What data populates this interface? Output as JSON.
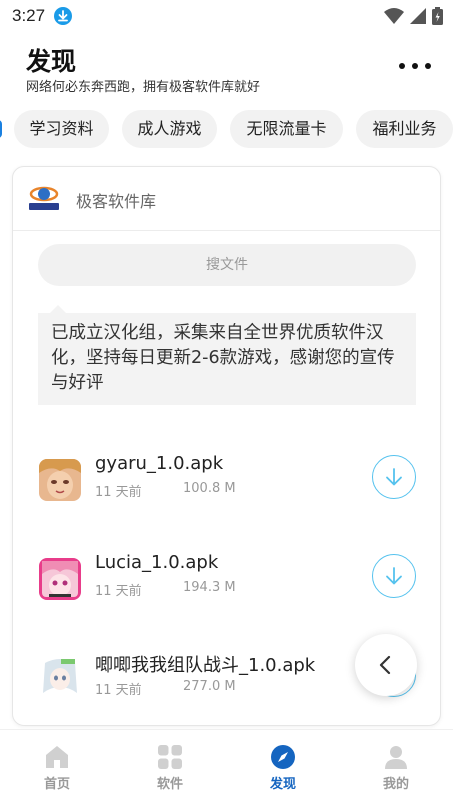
{
  "status_bar": {
    "time": "3:27"
  },
  "header": {
    "title": "发现",
    "subtitle": "网络何必东奔西跑，拥有极客软件库就好"
  },
  "chips": [
    "学习资料",
    "成人游戏",
    "无限流量卡",
    "福利业务"
  ],
  "card": {
    "site_name": "极客软件库",
    "search_placeholder": "搜文件",
    "notice": "已成立汉化组，采集来自全世界优质软件汉化，坚持每日更新2-6款游戏，感谢您的宣传与好评",
    "files": [
      {
        "name": "gyaru_1.0.apk",
        "date": "11 天前",
        "size": "100.8 M"
      },
      {
        "name": "Lucia_1.0.apk",
        "date": "11 天前",
        "size": "194.3 M"
      },
      {
        "name": "唧唧我我组队战斗_1.0.apk",
        "date": "11 天前",
        "size": "277.0 M"
      }
    ]
  },
  "bottom_nav": {
    "items": [
      {
        "label": "首页",
        "icon": "home-icon",
        "active": false
      },
      {
        "label": "软件",
        "icon": "grid-icon",
        "active": false
      },
      {
        "label": "发现",
        "icon": "compass-icon",
        "active": true
      },
      {
        "label": "我的",
        "icon": "user-icon",
        "active": false
      }
    ]
  },
  "colors": {
    "accent": "#1565c0",
    "download": "#55c2ee",
    "chip_bg": "#f2f2f2"
  }
}
